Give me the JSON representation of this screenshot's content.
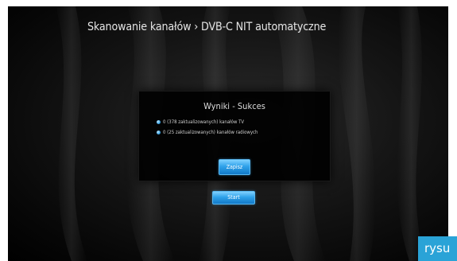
{
  "header": {
    "title": "Skanowanie kanałów › DVB-C NIT automatyczne"
  },
  "dialog": {
    "title": "Wyniki - Sukces",
    "results": [
      "0 (378 zaktualizowanych) kanałów TV",
      "0 (25 zaktualizowanych) kanałów radiowych"
    ],
    "save_label": "Zapisz"
  },
  "actions": {
    "start_label": "Start"
  },
  "watermark": {
    "text": "rysu"
  },
  "colors": {
    "accent": "#2fa2ea",
    "background": "#000000",
    "watermark": "#2aa3d7"
  },
  "icons": {
    "bullet": "bullet-dot-icon"
  }
}
